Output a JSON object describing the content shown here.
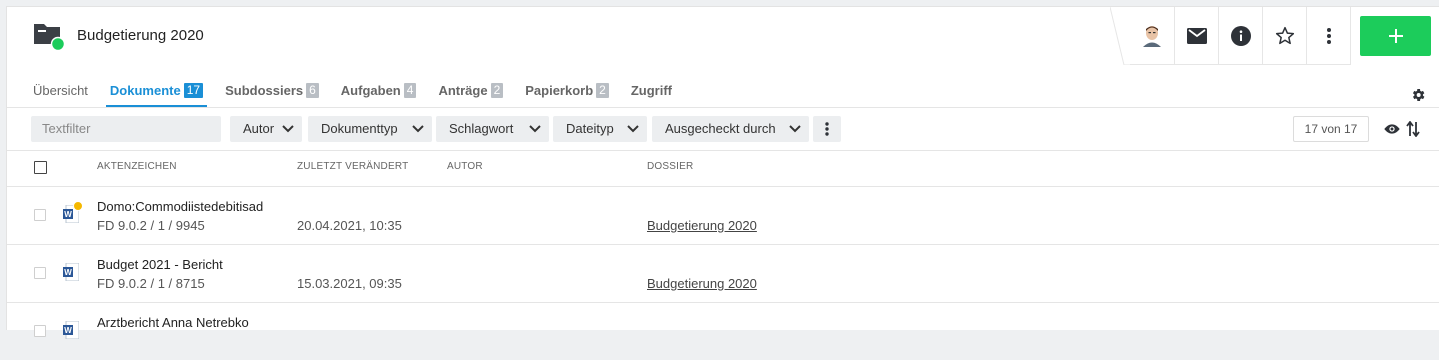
{
  "header": {
    "title": "Budgetierung 2020",
    "accent": "#1ccc5b",
    "actions": [
      "avatar",
      "mail-icon",
      "info-icon",
      "star-icon",
      "more-vert-icon"
    ],
    "add_label": "+"
  },
  "tabs": [
    {
      "label": "Übersicht",
      "badge": ""
    },
    {
      "label": "Dokumente",
      "badge": "17"
    },
    {
      "label": "Subdossiers",
      "badge": "6"
    },
    {
      "label": "Aufgaben",
      "badge": "4"
    },
    {
      "label": "Anträge",
      "badge": "2"
    },
    {
      "label": "Papierkorb",
      "badge": "2"
    },
    {
      "label": "Zugriff",
      "badge": ""
    }
  ],
  "filters": {
    "text_placeholder": "Textfilter",
    "dropdowns": [
      "Autor",
      "Dokumenttyp",
      "Schlagwort",
      "Dateityp",
      "Ausgecheckt durch"
    ],
    "count": "17 von 17"
  },
  "table": {
    "headers": [
      "AKTENZEICHEN",
      "ZULETZT VERÄNDERT",
      "AUTOR",
      "DOSSIER"
    ],
    "rows": [
      {
        "title": "Domo:Commodiistedebitisad",
        "ref": "FD 9.0.2 / 1 / 9945",
        "date": "20.04.2021, 10:35",
        "author": "",
        "dossier": "Budgetierung 2020"
      },
      {
        "title": "Budget 2021 - Bericht",
        "ref": "FD 9.0.2 / 1 / 8715",
        "date": "15.03.2021, 09:35",
        "author": "",
        "dossier": "Budgetierung 2020"
      },
      {
        "title": "Arztbericht Anna Netrebko",
        "ref": "",
        "date": "",
        "author": "",
        "dossier": ""
      }
    ]
  }
}
